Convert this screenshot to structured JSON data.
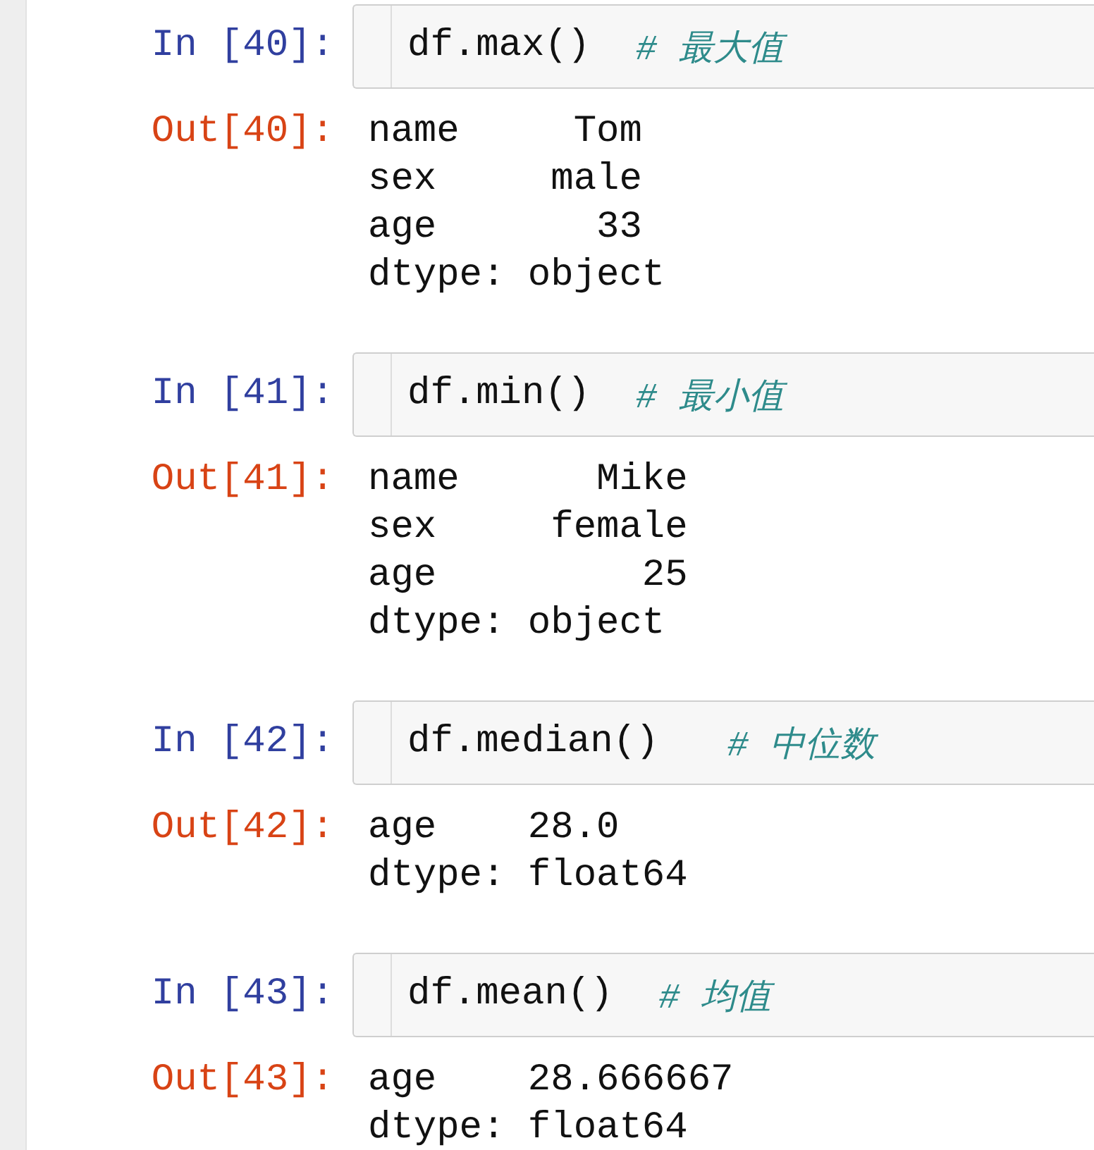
{
  "cells": [
    {
      "input_prompt": "In [40]:",
      "code": "df.max()  ",
      "comment": "# 最大值",
      "output_prompt": "Out[40]:",
      "output_lines": [
        "name     Tom",
        "sex     male",
        "age       33",
        "dtype: object"
      ]
    },
    {
      "input_prompt": "In [41]:",
      "code": "df.min()  ",
      "comment": "# 最小值",
      "output_prompt": "Out[41]:",
      "output_lines": [
        "name      Mike",
        "sex     female",
        "age         25",
        "dtype: object"
      ]
    },
    {
      "input_prompt": "In [42]:",
      "code": "df.median()   ",
      "comment": "# 中位数",
      "output_prompt": "Out[42]:",
      "output_lines": [
        "age    28.0",
        "dtype: float64"
      ]
    },
    {
      "input_prompt": "In [43]:",
      "code": "df.mean()  ",
      "comment": "# 均值",
      "output_prompt": "Out[43]:",
      "output_lines": [
        "age    28.666667",
        "dtype: float64"
      ]
    }
  ]
}
